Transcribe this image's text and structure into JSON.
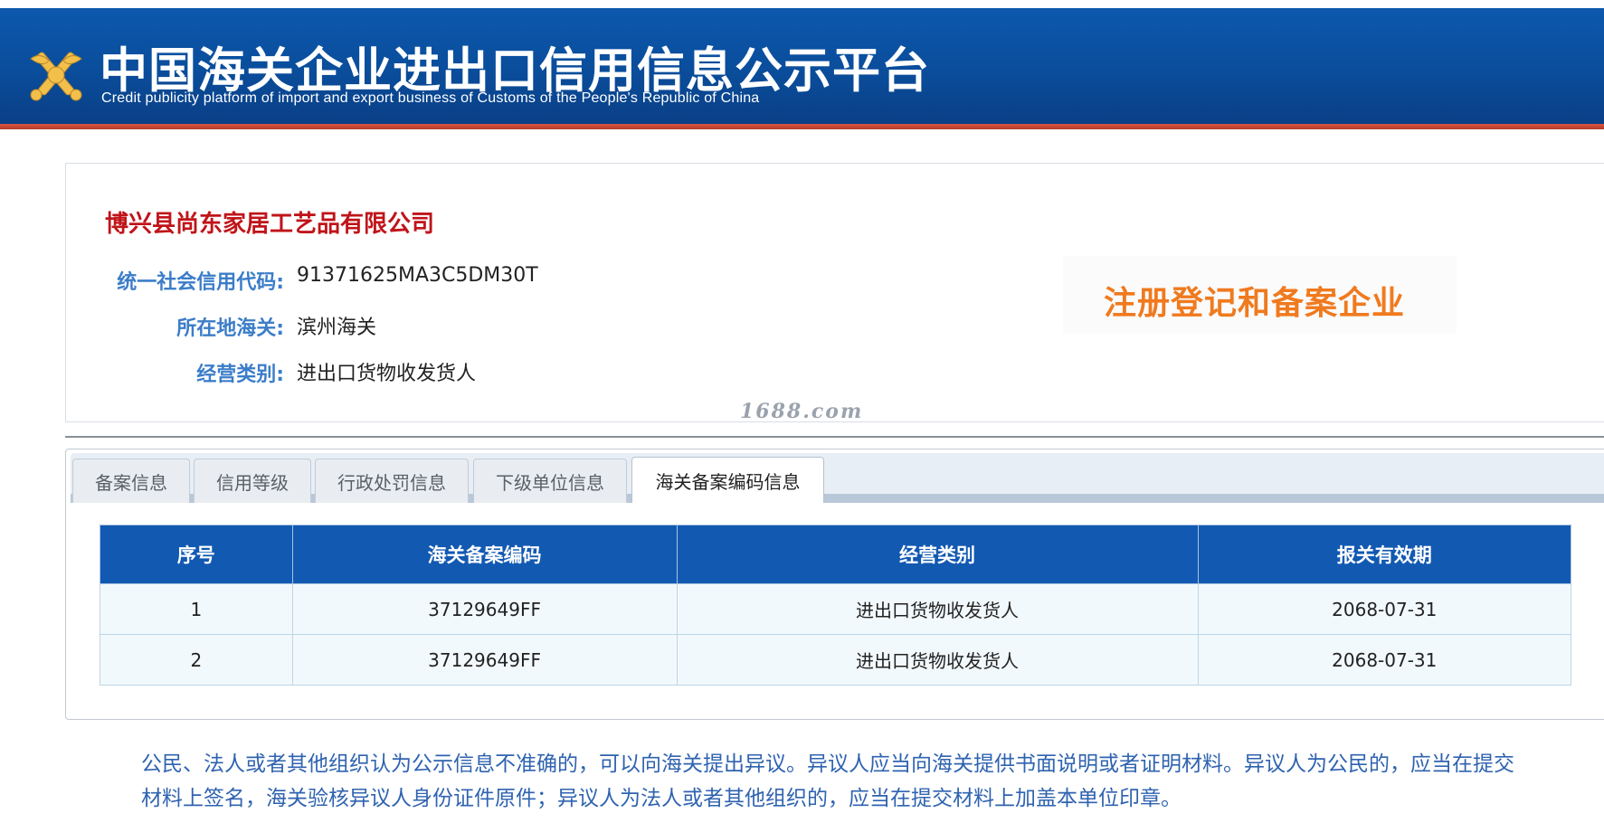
{
  "header": {
    "title_cn": "中国海关企业进出口信用信息公示平台",
    "title_en": "Credit publicity platform of import and export business of Customs of the People's Republic of China",
    "logo_icon": "customs-emblem-icon",
    "colors": {
      "banner": "#0d58ad",
      "stripe": "#c4432f"
    }
  },
  "company": {
    "name": "博兴县尚东家居工艺品有限公司",
    "fields": [
      {
        "label": "统一社会信用代码:",
        "value": "91371625MA3C5DM30T"
      },
      {
        "label": "所在地海关:",
        "value": "滨州海关"
      },
      {
        "label": "经营类别:",
        "value": "进出口货物收发货人"
      }
    ],
    "badge": "注册登记和备案企业",
    "watermark": "1688.com"
  },
  "tabs": [
    {
      "label": "备案信息",
      "active": false
    },
    {
      "label": "信用等级",
      "active": false
    },
    {
      "label": "行政处罚信息",
      "active": false
    },
    {
      "label": "下级单位信息",
      "active": false
    },
    {
      "label": "海关备案编码信息",
      "active": true
    }
  ],
  "table": {
    "headers": [
      "序号",
      "海关备案编码",
      "经营类别",
      "报关有效期"
    ],
    "rows": [
      [
        "1",
        "37129649FF",
        "进出口货物收发货人",
        "2068-07-31"
      ],
      [
        "2",
        "37129649FF",
        "进出口货物收发货人",
        "2068-07-31"
      ]
    ]
  },
  "notice": "公民、法人或者其他组织认为公示信息不准确的，可以向海关提出异议。异议人应当向海关提供书面说明或者证明材料。异议人为公民的，应当在提交材料上签名，海关验核异议人身份证件原件；异议人为法人或者其他组织的，应当在提交材料上加盖本单位印章。"
}
